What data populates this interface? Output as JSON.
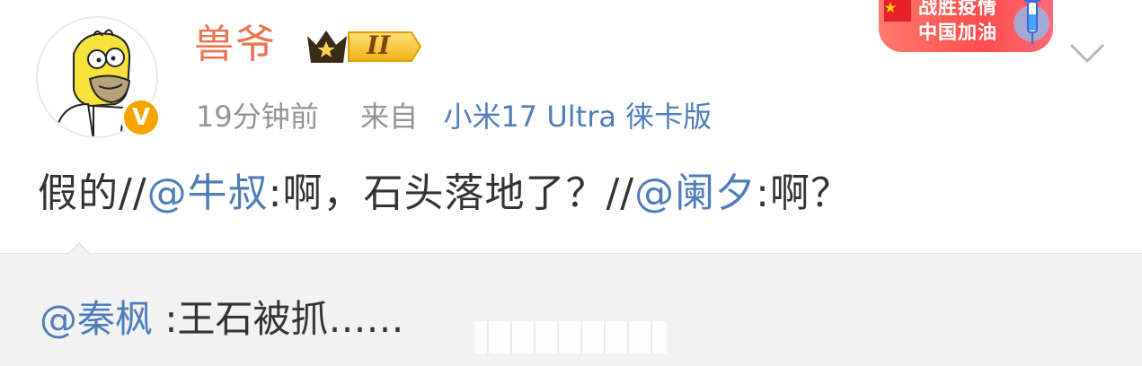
{
  "post": {
    "username": "兽爷",
    "level_badge": "II",
    "verified_mark": "V",
    "timestamp": "19分钟前",
    "source_prefix": "来自",
    "source_device": "小米17 Ultra 徕卡版",
    "promo_badge": {
      "line1": "战胜疫情",
      "line2": "中国加油"
    },
    "content": {
      "part1": "假的//",
      "mention1": "@牛叔",
      "part2": ":啊，石头落地了？//",
      "mention2": "@阑夕",
      "part3": ":啊？"
    }
  },
  "quote": {
    "mention": "@秦枫",
    "text": " :王石被抓……"
  },
  "colors": {
    "username": "#eb7350",
    "link": "#4f7db8",
    "meta": "#939393",
    "text": "#333333",
    "quote_bg": "#f2f2f2",
    "verified": "#f7a400"
  },
  "icons": {
    "avatar": "cartoon-avatar-icon",
    "verified": "verified-v-icon",
    "level": "crown-level-icon",
    "more": "chevron-down-icon",
    "promo": "flag-syringe-promo-icon"
  }
}
